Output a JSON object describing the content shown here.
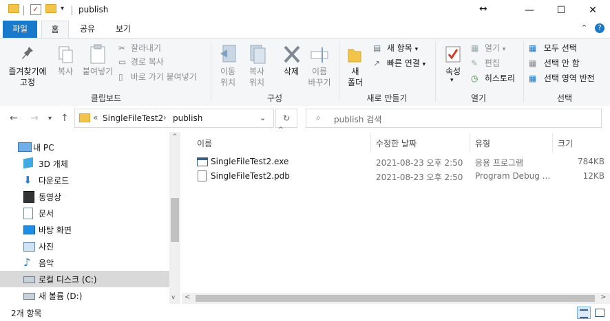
{
  "titlebar": {
    "title": "publish",
    "resize_glyph": "↔",
    "min_glyph": "—",
    "max_glyph": "☐",
    "close_glyph": "✕"
  },
  "ribbon_tabs": {
    "file": "파일",
    "home": "홈",
    "share": "공유",
    "view": "보기"
  },
  "ribbon": {
    "clipboard": {
      "pin_label": "즐겨찾기에\n고정",
      "copy": "복사",
      "paste": "붙여넣기",
      "cut": "잘라내기",
      "copy_path": "경로 복사",
      "paste_shortcut": "바로 가기 붙여넣기",
      "group": "클립보드"
    },
    "organize": {
      "move_to": "이동\n위치",
      "copy_to": "복사\n위치",
      "delete": "삭제",
      "rename": "이름\n바꾸기",
      "group": "구성"
    },
    "new": {
      "new_item": "새 항목",
      "easy_access": "빠른 연결",
      "new_folder": "새\n폴더",
      "group": "새로 만들기"
    },
    "open": {
      "properties": "속성",
      "open": "열기",
      "edit": "편집",
      "history": "히스토리",
      "group": "열기"
    },
    "select": {
      "select_all": "모두 선택",
      "select_none": "선택 안 함",
      "invert": "선택 영역 반전",
      "group": "선택"
    }
  },
  "address": {
    "chevron": "«",
    "crumb1": "SingleFileTest2",
    "crumb_sep": "›",
    "crumb2": "publish",
    "search_placeholder": "publish 검색"
  },
  "navpane": {
    "items": [
      {
        "label": "내 PC",
        "icon": "pc-icon"
      },
      {
        "label": "3D 개체",
        "icon": "cube-icon"
      },
      {
        "label": "다운로드",
        "icon": "download-icon"
      },
      {
        "label": "동영상",
        "icon": "video-icon"
      },
      {
        "label": "문서",
        "icon": "document-icon"
      },
      {
        "label": "바탕 화면",
        "icon": "desktop-icon"
      },
      {
        "label": "사진",
        "icon": "picture-icon"
      },
      {
        "label": "음악",
        "icon": "music-icon"
      },
      {
        "label": "로컬 디스크 (C:)",
        "icon": "drive-icon"
      },
      {
        "label": "새 볼륨 (D:)",
        "icon": "drive-icon"
      }
    ]
  },
  "list": {
    "columns": {
      "name": "이름",
      "modified": "수정한 날짜",
      "type": "유형",
      "size": "크기"
    },
    "rows": [
      {
        "name": "SingleFileTest2.exe",
        "modified": "2021-08-23 오후 2:50",
        "type": "응용 프로그램",
        "size": "784KB"
      },
      {
        "name": "SingleFileTest2.pdb",
        "modified": "2021-08-23 오후 2:50",
        "type": "Program Debug ...",
        "size": "12KB"
      }
    ]
  },
  "status": {
    "count": "2개 항목"
  },
  "colors": {
    "accent": "#1979ca",
    "ribbon_bg": "#f5f6f7",
    "selected_bg": "#d9d9d9"
  }
}
